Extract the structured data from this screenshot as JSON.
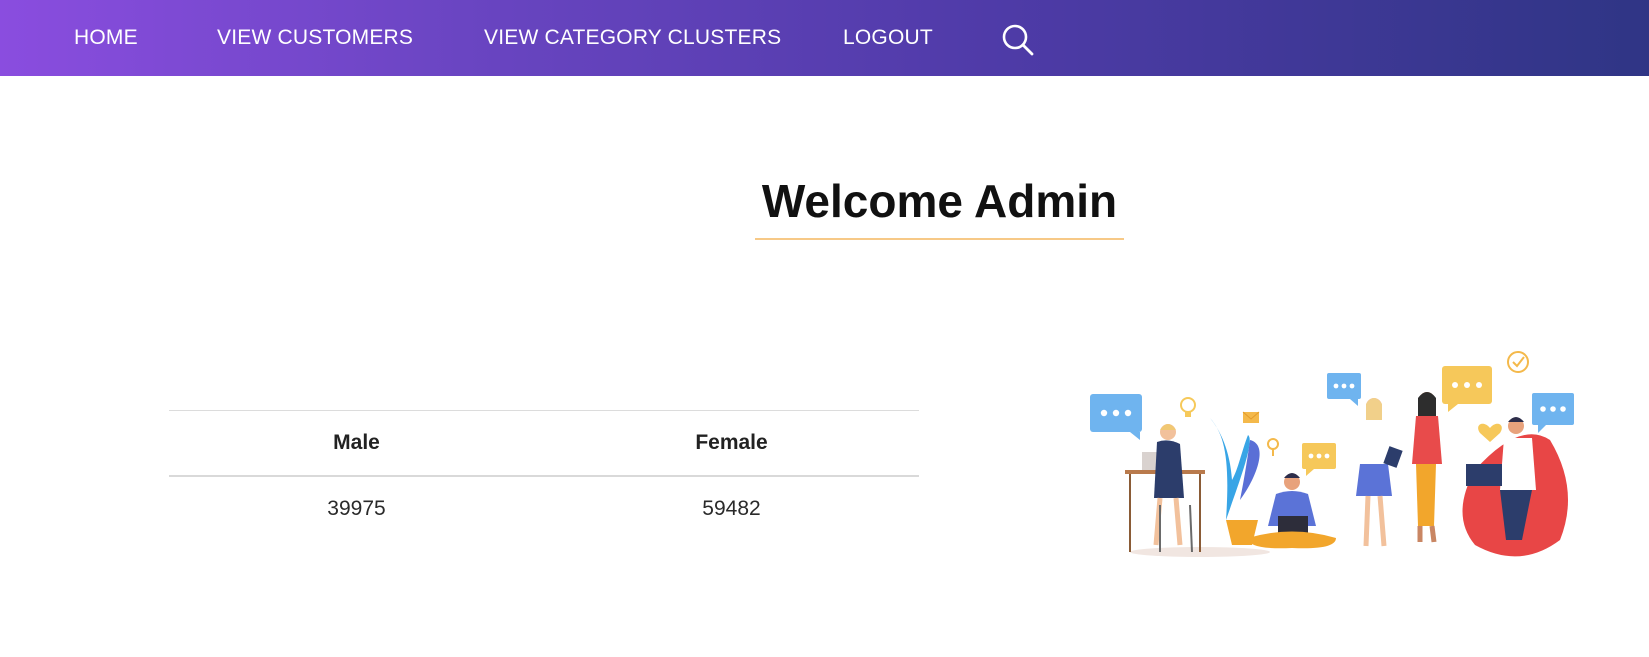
{
  "nav": {
    "items": [
      {
        "label": "HOME"
      },
      {
        "label": "VIEW CUSTOMERS"
      },
      {
        "label": "VIEW CATEGORY CLUSTERS"
      },
      {
        "label": "LOGOUT"
      }
    ],
    "search_icon": "search-icon"
  },
  "main": {
    "title": "Welcome Admin"
  },
  "table": {
    "headers": [
      "Male",
      "Female"
    ],
    "rows": [
      [
        "39975",
        "59482"
      ]
    ]
  },
  "illustration": {
    "icon": "team-collaboration-illustration"
  },
  "colors": {
    "nav_gradient_start": "#8a4ddf",
    "nav_gradient_end": "#2f3585",
    "title_underline": "#f7c987"
  }
}
